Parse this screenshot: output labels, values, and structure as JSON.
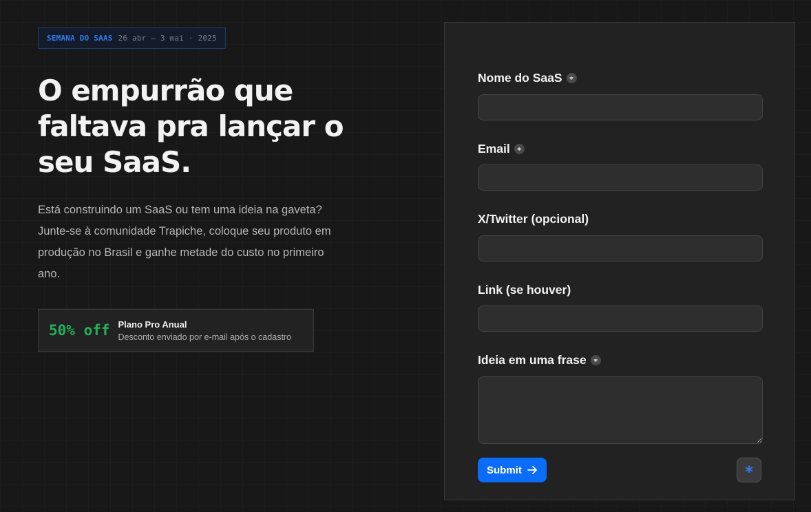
{
  "event": {
    "name": "SEMANA DO SAAS",
    "dates": "26 abr — 3 mai · 2025"
  },
  "hero": {
    "headline": "O empurrão que faltava pra lançar o seu SaaS.",
    "intro": "Está construindo um SaaS ou tem uma ideia na gaveta? Junte-se à comunidade Trapiche, coloque seu produto em produção no Brasil e ganhe metade do custo no primeiro ano."
  },
  "offer": {
    "discount": "50% off",
    "plan": "Plano Pro Anual",
    "note": "Desconto enviado por e-mail após o cadastro"
  },
  "form": {
    "required_marker": "*",
    "fields": [
      {
        "label": "Nome do SaaS",
        "required": true,
        "value": ""
      },
      {
        "label": "Email",
        "required": true,
        "value": ""
      },
      {
        "label": "X/Twitter (opcional)",
        "required": false,
        "value": ""
      },
      {
        "label": "Link (se houver)",
        "required": false,
        "value": ""
      },
      {
        "label": "Ideia em uma frase",
        "required": true,
        "value": ""
      }
    ],
    "submit_label": "Submit",
    "submit_icon": "arrow-right-icon",
    "corner_button_glyph": "*",
    "corner_button_icon": "asterisk-icon"
  },
  "colors": {
    "accent": "#0b6cf7",
    "offer_green": "#23b05c",
    "badge_blue": "#2f7bf0"
  }
}
